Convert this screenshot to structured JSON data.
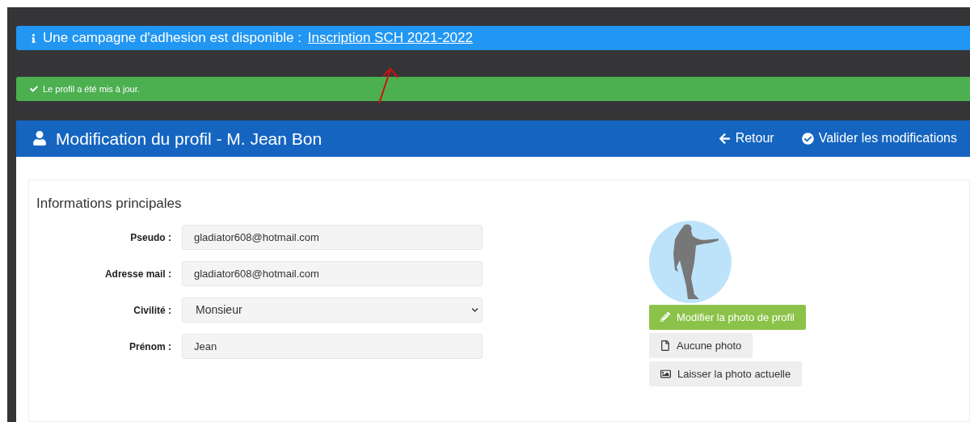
{
  "info_banner": {
    "text": "Une campagne d'adhesion est disponible :",
    "link": "Inscription SCH 2021-2022"
  },
  "success_banner": {
    "text": "Le profil a été mis à jour."
  },
  "header": {
    "title": "Modification du profil - M. Jean Bon",
    "actions": [
      {
        "kind": "back",
        "label": "Retour"
      },
      {
        "kind": "validate",
        "label": "Valider les modifications"
      }
    ]
  },
  "section": {
    "title": "Informations principales",
    "fields": [
      {
        "kind": "text",
        "label": "Pseudo :",
        "value": "gladiator608@hotmail.com"
      },
      {
        "kind": "text",
        "label": "Adresse mail :",
        "value": "gladiator608@hotmail.com"
      },
      {
        "kind": "select",
        "label": "Civilité :",
        "value": "Monsieur"
      },
      {
        "kind": "text",
        "label": "Prénom :",
        "value": "Jean"
      }
    ]
  },
  "photo": {
    "buttons": [
      {
        "kind": "edit",
        "label": "Modifier la photo de profil"
      },
      {
        "kind": "none",
        "label": "Aucune photo"
      },
      {
        "kind": "keep",
        "label": "Laisser la photo actuelle"
      }
    ]
  }
}
